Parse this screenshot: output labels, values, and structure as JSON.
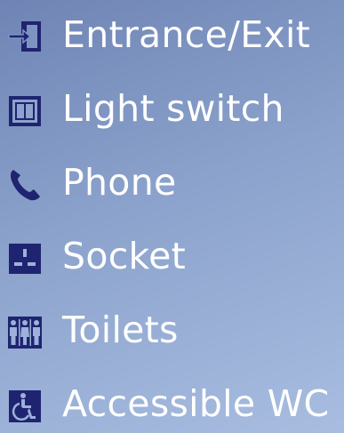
{
  "colors": {
    "icon_fill": "#1f2470",
    "text": "#ffffff",
    "background_top": "#6f84b4",
    "background_bottom": "#a8bde0"
  },
  "legend": {
    "items": [
      {
        "icon": "door-exit-icon",
        "label": "Entrance/Exit"
      },
      {
        "icon": "light-switch-icon",
        "label": "Light switch"
      },
      {
        "icon": "phone-icon",
        "label": "Phone"
      },
      {
        "icon": "socket-icon",
        "label": "Socket"
      },
      {
        "icon": "toilets-icon",
        "label": "Toilets"
      },
      {
        "icon": "wheelchair-icon",
        "label": "Accessible WC"
      }
    ]
  }
}
